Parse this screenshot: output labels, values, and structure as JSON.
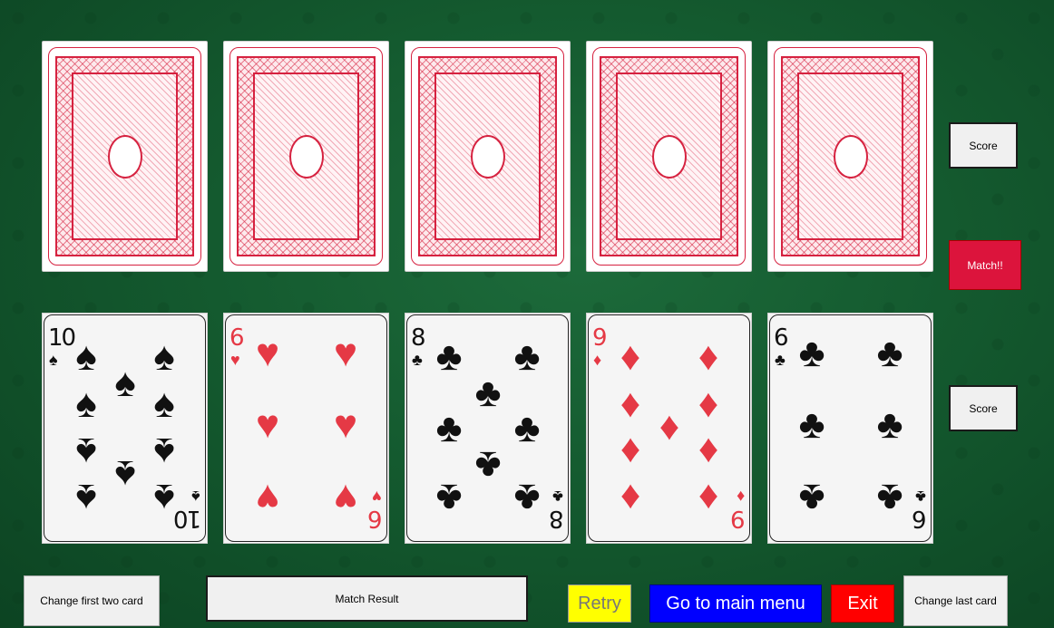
{
  "cards_top": [
    {
      "state": "face-down"
    },
    {
      "state": "face-down"
    },
    {
      "state": "face-down"
    },
    {
      "state": "face-down"
    },
    {
      "state": "face-down"
    }
  ],
  "cards_bottom": [
    {
      "rank": "10",
      "suit": "spades",
      "symbol": "♠",
      "color": "black"
    },
    {
      "rank": "6",
      "suit": "hearts",
      "symbol": "♥",
      "color": "red"
    },
    {
      "rank": "8",
      "suit": "clubs",
      "symbol": "♣",
      "color": "black"
    },
    {
      "rank": "9",
      "suit": "diamonds",
      "symbol": "♦",
      "color": "red"
    },
    {
      "rank": "6",
      "suit": "clubs",
      "symbol": "♣",
      "color": "black"
    }
  ],
  "side": {
    "score_top_label": "Score",
    "match_label": "Match!!",
    "score_bottom_label": "Score"
  },
  "footer": {
    "change_first_label": "Change first two card",
    "match_result_label": "Match Result",
    "retry_label": "Retry",
    "main_menu_label": "Go to main menu",
    "exit_label": "Exit",
    "change_last_label": "Change last card"
  },
  "colors": {
    "felt": "#145a2f",
    "card_back": "#d62240",
    "match": "#dc143c",
    "retry": "#ffff00",
    "main_menu": "#0000ff",
    "exit": "#ff0000"
  }
}
